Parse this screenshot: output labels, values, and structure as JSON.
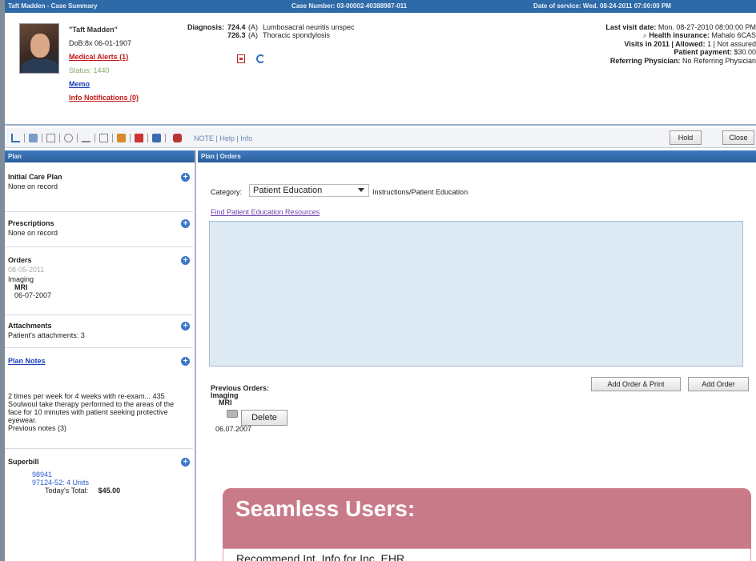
{
  "titlebar": {
    "left": "Taft Madden - Case Summary",
    "case": "Case Number: 03-00002-40388987-011",
    "date": "Date of service: Wed. 08-24-2011 07:00:00 PM"
  },
  "patient": {
    "name": "\"Taft Madden\"",
    "dob": "DoB:8x 06-01-1907",
    "medical_alerts": "Medical Alerts (1)",
    "status": "Status: 1440",
    "memo": "Memo",
    "notifications": "Info Notifications (0)"
  },
  "diagnosis": {
    "label": "Diagnosis:",
    "rows": [
      {
        "code": "724.4",
        "flag": "(A)",
        "text": "Lumbosacral neuritis unspec"
      },
      {
        "code": "726.3",
        "flag": "(A)",
        "text": "Thoracic spondylosis"
      }
    ]
  },
  "visit": {
    "last_visit_label": "Last visit date:",
    "last_visit_value": "Mon. 08-27-2010 08:00:00 PM",
    "insurance_label": "Health insurance:",
    "insurance_value": "Mahalo 6CAS",
    "visits_label": "Visits in 2011 | Allowed:",
    "visits_value": "1 | Not assured",
    "payment_label": "Patient payment:",
    "payment_value": "$30.00",
    "physician_label": "Referring Physician:",
    "physician_value": "No Referring Physician"
  },
  "toolbar": {
    "links": "NOTE | Help | Info",
    "hold_label": "Hold",
    "close_label": "Close"
  },
  "left_pane": {
    "header": "Plan",
    "initial_care_title": "Initial Care Plan",
    "initial_care_body": "None on record",
    "prescriptions_title": "Prescriptions",
    "prescriptions_body": "None on record",
    "orders_title": "Orders",
    "orders_date": "08-05-2011",
    "orders_type": "Imaging",
    "orders_item": "MRI",
    "orders_item_date": "06-07-2007",
    "attachments_title": "Attachments",
    "attachments_body": "Patient's attachments: 3",
    "plan_notes_title": "Plan Notes",
    "plan_notes_body": "2 times per week for 4 weeks with re-exam... 435 Soulwoul take therapy performed to the areas of the face for 10 minutes with patient seeking protective eyewear.",
    "previous_notes": "Previous notes (3)",
    "superbill_title": "Superbill",
    "superbill_code": "98941",
    "superbill_line": "97124-52: 4 Units",
    "superbill_total_label": "Today's Total:",
    "superbill_total_value": "$45.00"
  },
  "right_pane": {
    "header": "Plan | Orders",
    "category_label": "Category:",
    "category_value": "Patient Education",
    "category_extra": "Instructions/Patient Education",
    "find_link": "Find Patient Education Resources",
    "add_print_label": "Add Order & Print",
    "add_order_label": "Add Order",
    "previous_orders": "Previous Orders:",
    "prev_type": "Imaging",
    "prev_item": "MRI",
    "delete_label": "Delete",
    "prev_date": "06.07.2007"
  },
  "banner": {
    "title": "Seamless Users:",
    "subtitle": "Recommend Int. Info for Inc. EHR"
  },
  "colors": {
    "titlebar": "#2f6aa8",
    "banner": "#c97a88",
    "notes_area": "#dde9f3"
  }
}
